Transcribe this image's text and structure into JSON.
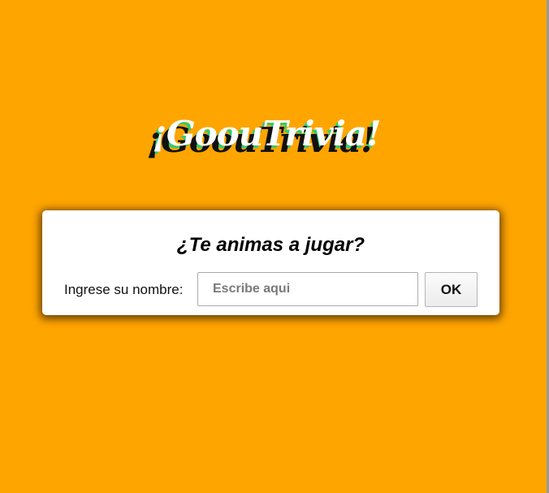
{
  "app": {
    "logo_text": "¡GoouTrivia!"
  },
  "login_card": {
    "title": "¿Te animas a jugar?",
    "name_label": "Ingrese su nombre:",
    "name_input": {
      "value": "",
      "placeholder": "Escribe aqui"
    },
    "ok_label": "OK"
  },
  "colors": {
    "background": "#ffa500",
    "card": "#ffffff",
    "logo_text": "#ffffff",
    "logo_shadow_dark": "#111111",
    "logo_shadow_green": "#2ecc71"
  }
}
